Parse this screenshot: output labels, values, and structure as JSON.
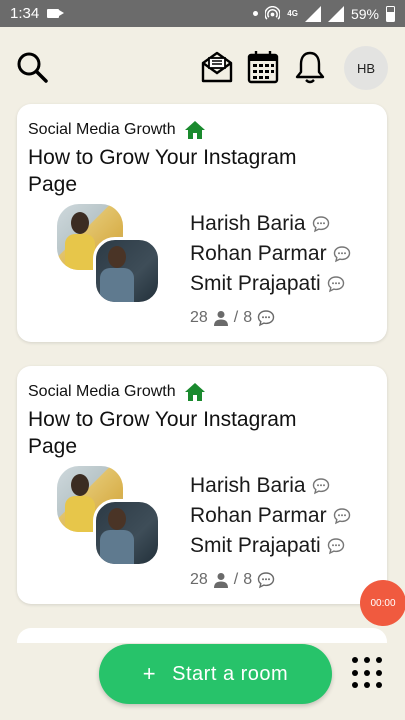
{
  "status_bar": {
    "time": "1:34",
    "network": "4G",
    "battery": "59%"
  },
  "header": {
    "avatar_initials": "HB"
  },
  "rooms": [
    {
      "club": "Social Media Growth",
      "title": "How to Grow Your Instagram Page",
      "speakers": [
        "Harish Baria",
        "Rohan Parmar",
        "Smit Prajapati"
      ],
      "listeners": "28",
      "separator": "/",
      "speaker_count": "8"
    },
    {
      "club": "Social Media Growth",
      "title": "How to Grow Your Instagram Page",
      "speakers": [
        "Harish Baria",
        "Rohan Parmar",
        "Smit Prajapati"
      ],
      "listeners": "28",
      "separator": "/",
      "speaker_count": "8"
    }
  ],
  "timer": "00:00",
  "start_room": {
    "plus": "+",
    "label": "Start a room"
  },
  "colors": {
    "accent_green": "#27c36a",
    "home_green": "#1a8a2e",
    "timer_red": "#f05a3f",
    "background": "#f2efe4"
  }
}
